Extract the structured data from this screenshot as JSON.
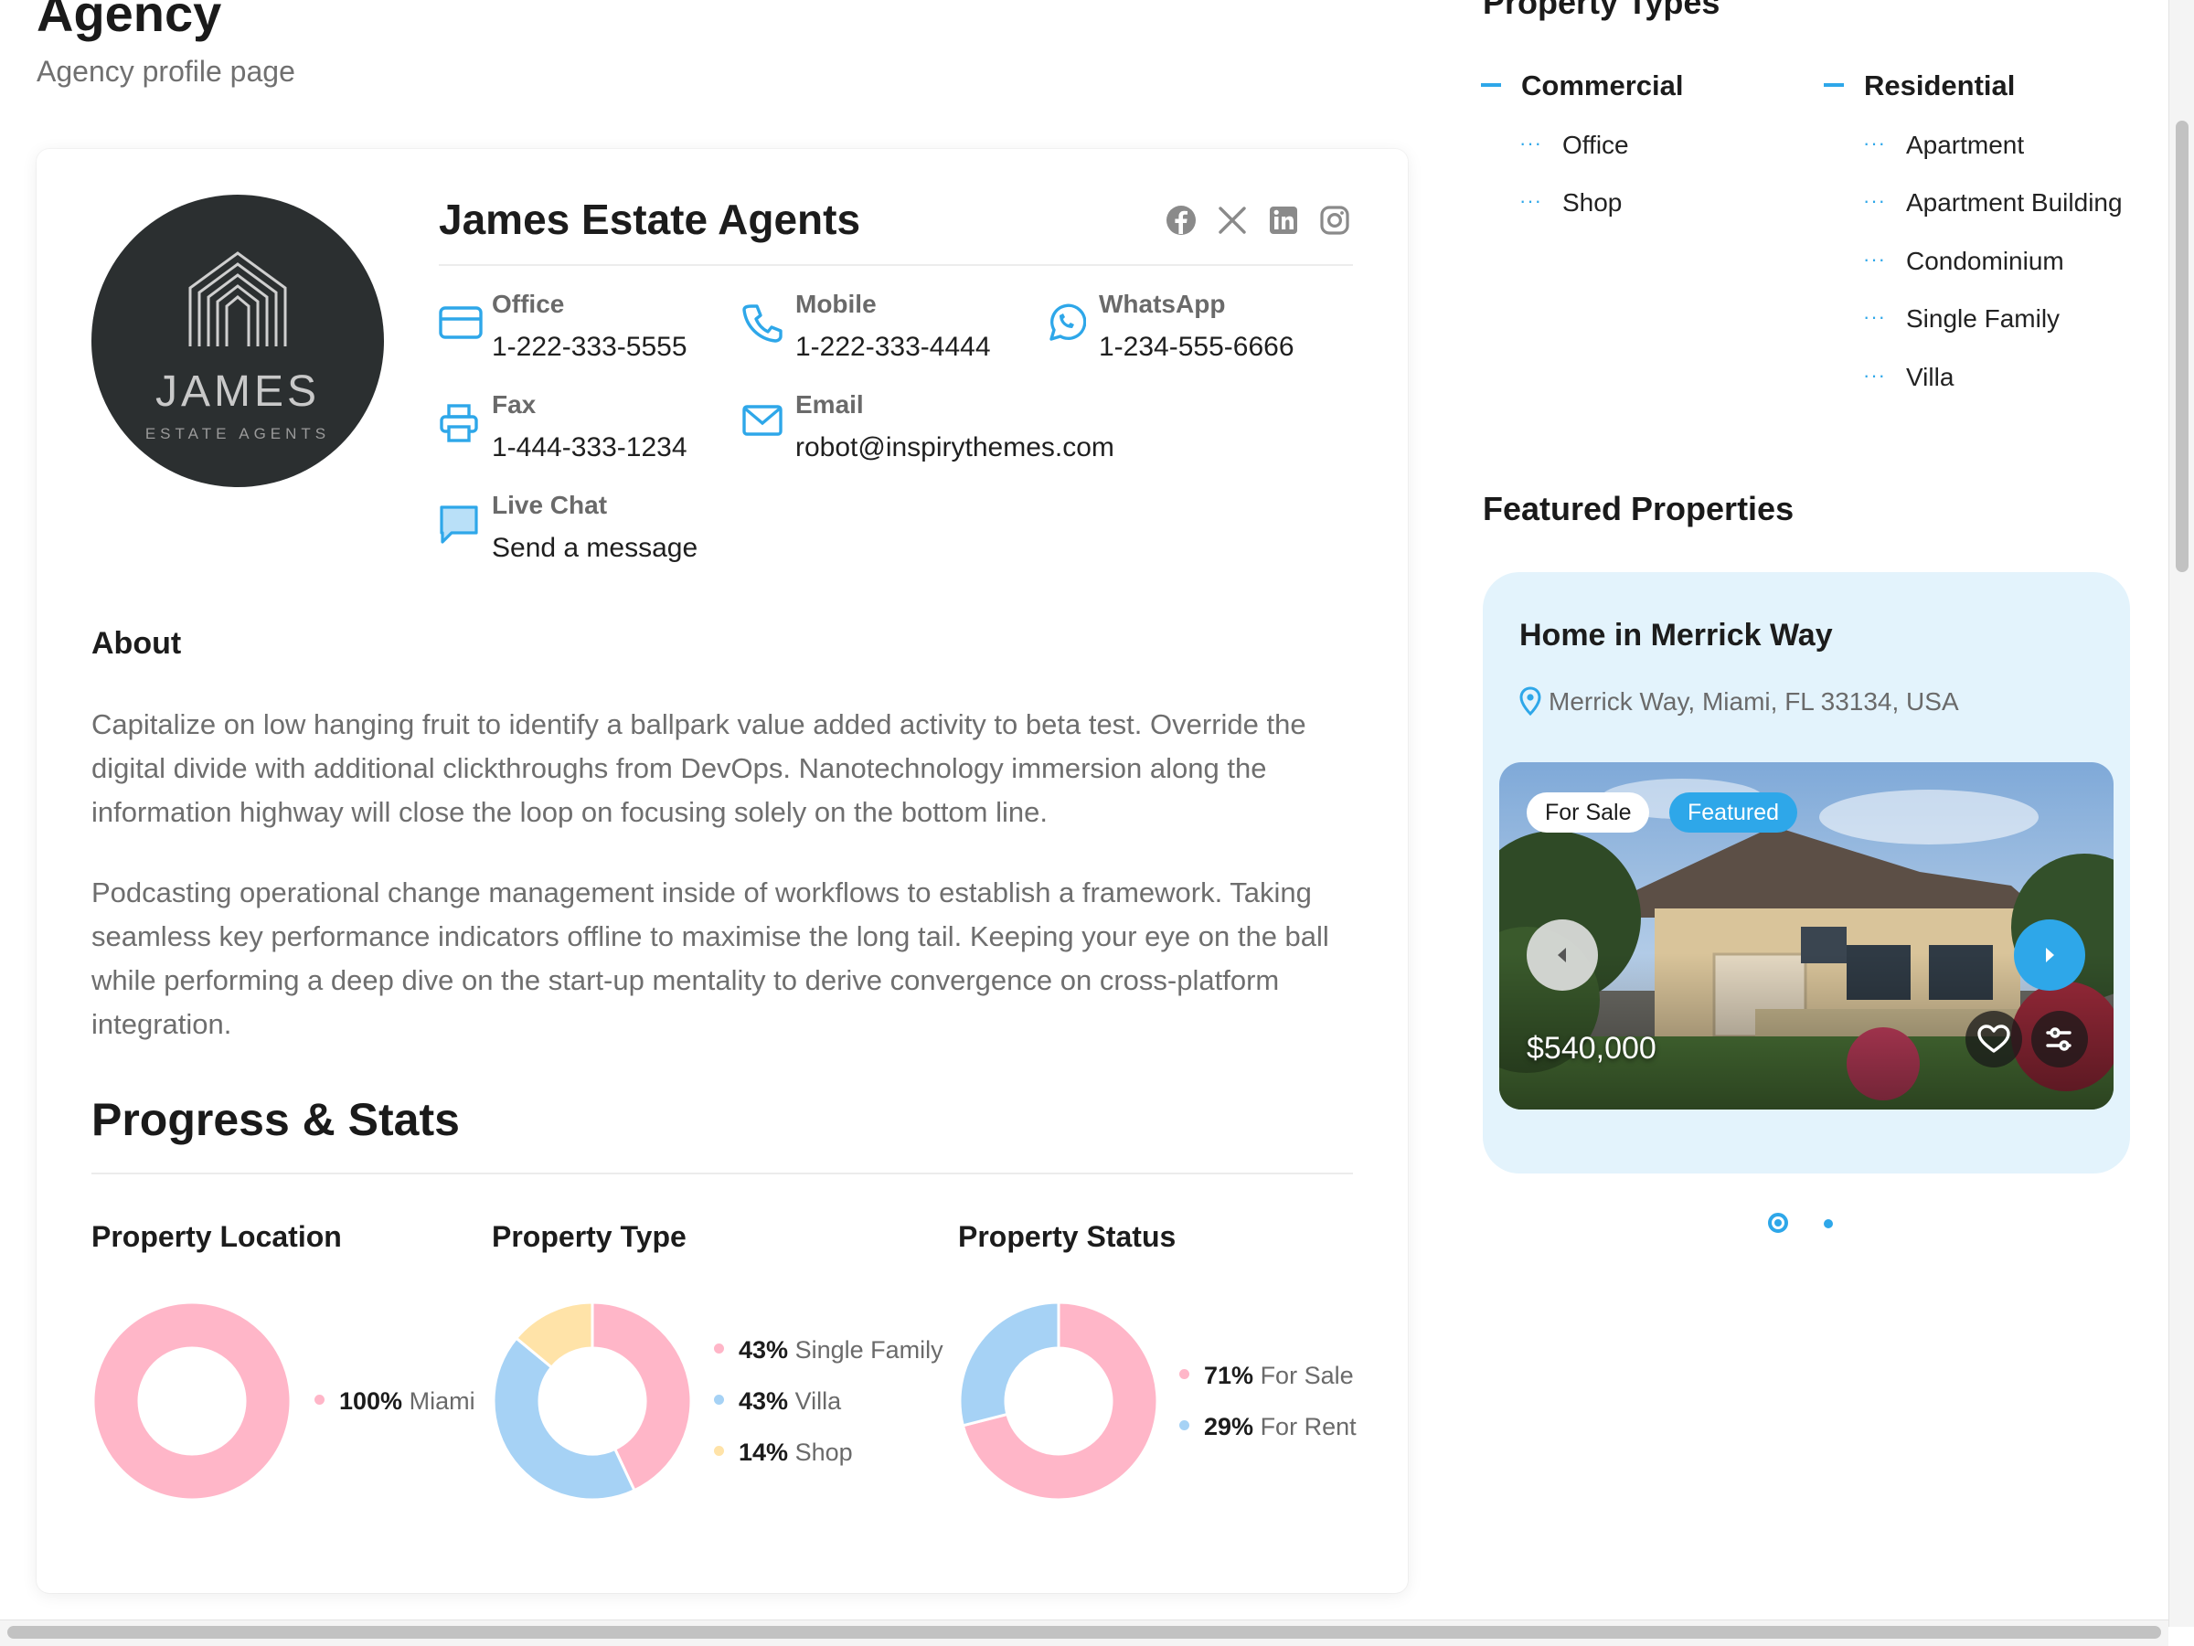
{
  "page": {
    "title": "Agency",
    "subtitle": "Agency profile page"
  },
  "agency": {
    "logo_word": "JAMES",
    "logo_tagline": "ESTATE AGENTS",
    "name": "James Estate Agents",
    "social_icons": [
      "facebook-icon",
      "x-icon",
      "linkedin-icon",
      "instagram-icon"
    ],
    "contacts": {
      "office": {
        "label": "Office",
        "value": "1-222-333-5555",
        "icon": "card-icon"
      },
      "mobile": {
        "label": "Mobile",
        "value": "1-222-333-4444",
        "icon": "phone-icon"
      },
      "whatsapp": {
        "label": "WhatsApp",
        "value": "1-234-555-6666",
        "icon": "whatsapp-icon"
      },
      "fax": {
        "label": "Fax",
        "value": "1-444-333-1234",
        "icon": "printer-icon"
      },
      "email": {
        "label": "Email",
        "value": "robot@inspirythemes.com",
        "icon": "mail-icon"
      },
      "chat": {
        "label": "Live Chat",
        "value": "Send a message",
        "icon": "chat-icon"
      }
    }
  },
  "about": {
    "title": "About",
    "paragraphs": [
      "Capitalize on low hanging fruit to identify a ballpark value added activity to beta test. Override the digital divide with additional clickthroughs from DevOps. Nanotechnology immersion along the information highway will close the loop on focusing solely on the bottom line.",
      "Podcasting operational change management inside of workflows to establish a framework. Taking seamless key performance indicators offline to maximise the long tail. Keeping your eye on the ball while performing a deep dive on the start-up mentality to derive convergence on cross-platform integration."
    ]
  },
  "stats": {
    "title": "Progress & Stats"
  },
  "colors": {
    "accent": "#2ea7e9",
    "pink": "#ffb6c8",
    "blue": "#a6d2f5",
    "yellow": "#ffe3a8"
  },
  "chart_data": [
    {
      "type": "pie",
      "title": "Property Location",
      "series": [
        {
          "name": "Miami",
          "percent": "100%",
          "value": 100,
          "color": "#ffb6c8"
        }
      ]
    },
    {
      "type": "pie",
      "title": "Property Type",
      "series": [
        {
          "name": "Single Family",
          "percent": "43%",
          "value": 43,
          "color": "#ffb6c8"
        },
        {
          "name": "Villa",
          "percent": "43%",
          "value": 43,
          "color": "#a6d2f5"
        },
        {
          "name": "Shop",
          "percent": "14%",
          "value": 14,
          "color": "#ffe3a8"
        }
      ]
    },
    {
      "type": "pie",
      "title": "Property Status",
      "series": [
        {
          "name": "For Sale",
          "percent": "71%",
          "value": 71,
          "color": "#ffb6c8"
        },
        {
          "name": "For Rent",
          "percent": "29%",
          "value": 29,
          "color": "#a6d2f5"
        }
      ]
    }
  ],
  "sidebar": {
    "property_types_title": "Property Types",
    "categories": [
      {
        "label": "Commercial",
        "items": [
          "Office",
          "Shop"
        ]
      },
      {
        "label": "Residential",
        "items": [
          "Apartment",
          "Apartment Building",
          "Condominium",
          "Single Family",
          "Villa"
        ]
      }
    ],
    "featured_title": "Featured Properties",
    "featured": {
      "name": "Home in Merrick Way",
      "address": "Merrick Way, Miami, FL 33134, USA",
      "badges": [
        "For Sale",
        "Featured"
      ],
      "price": "$540,000",
      "pager": {
        "count": 2,
        "active": 1
      }
    }
  }
}
